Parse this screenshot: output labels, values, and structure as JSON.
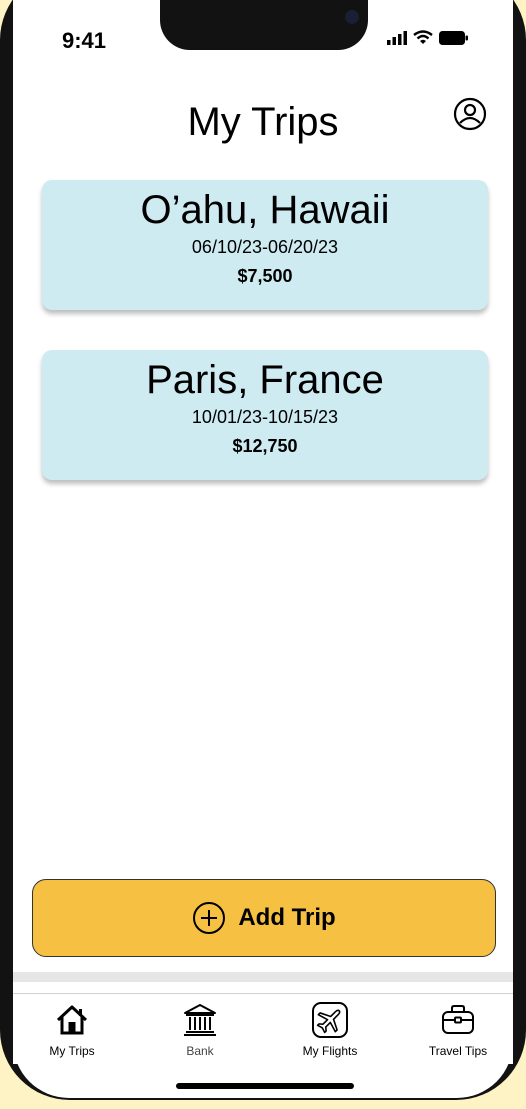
{
  "status_bar": {
    "time": "9:41"
  },
  "header": {
    "title": "My Trips"
  },
  "trips": [
    {
      "name": "O’ahu, Hawaii",
      "dates": "06/10/23-06/20/23",
      "cost": "$7,500"
    },
    {
      "name": "Paris, France",
      "dates": "10/01/23-10/15/23",
      "cost": "$12,750"
    }
  ],
  "add_trip": {
    "label": "Add Trip",
    "icon": "plus-circle-icon"
  },
  "tab_bar": {
    "items": [
      {
        "label": "My Trips",
        "icon": "home-icon"
      },
      {
        "label": "Bank",
        "icon": "bank-icon"
      },
      {
        "label": "My Flights",
        "icon": "airplane-icon"
      },
      {
        "label": "Travel Tips",
        "icon": "briefcase-icon"
      }
    ]
  },
  "colors": {
    "background": "#fdf3c4",
    "card": "#cdebf1",
    "accent": "#f6c143"
  }
}
